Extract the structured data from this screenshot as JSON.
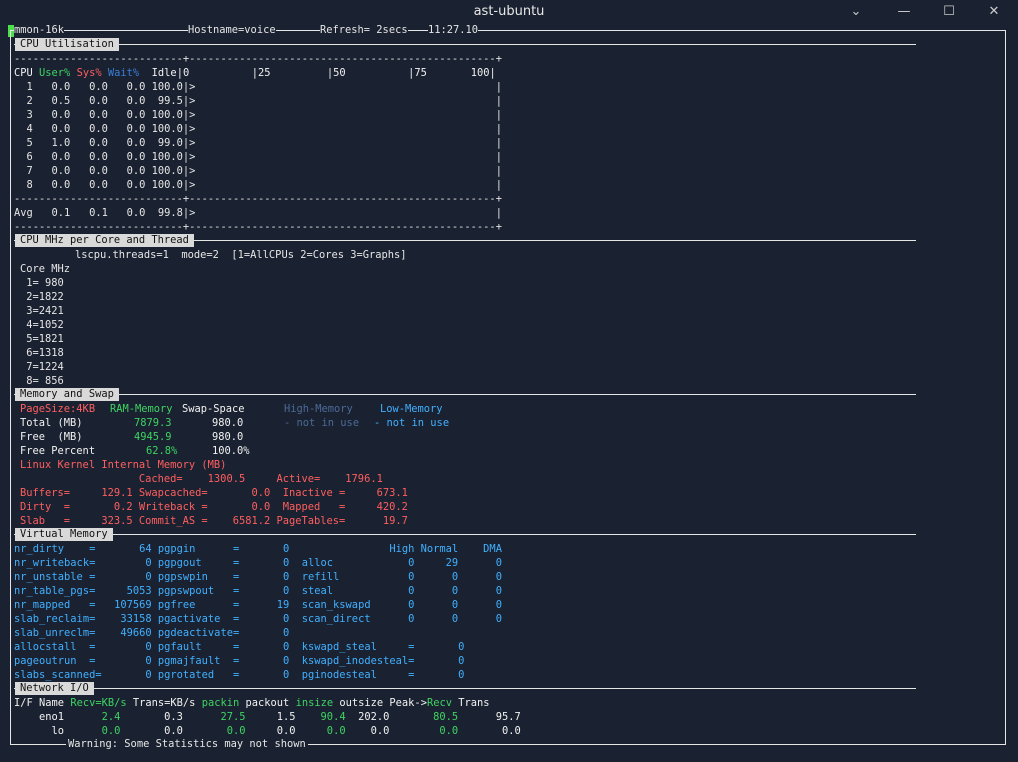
{
  "window": {
    "title": "ast-ubuntu",
    "min": "⌄",
    "restore": "—",
    "max": "☐",
    "close": "✕"
  },
  "header": {
    "left": "mmon-16k",
    "host": "Hostname=voice",
    "refresh": "Refresh= 2secs",
    "time": "11:27.10"
  },
  "sections": {
    "cpu": "CPU Utilisation",
    "mhz": "CPU MHz per Core and Thread",
    "mem": "Memory and Swap",
    "vm": "Virtual Memory",
    "net": "Network I/O"
  },
  "cpu": {
    "sep": "---------------------------+-------------------------------------------------+",
    "head": {
      "cpu": "CPU ",
      "user": "User%",
      "sys": "Sys%",
      "wait": "Wait%",
      "rest": "  Idle|0          |25         |50          |75       100|"
    },
    "rows": [
      "  1   0.0   0.0   0.0 100.0|>                                                |",
      "  2   0.5   0.0   0.0  99.5|>                                                |",
      "  3   0.0   0.0   0.0 100.0|>                                                |",
      "  4   0.0   0.0   0.0 100.0|>                                                |",
      "  5   1.0   0.0   0.0  99.0|>                                                |",
      "  6   0.0   0.0   0.0 100.0|>                                                |",
      "  7   0.0   0.0   0.0 100.0|>                                                |",
      "  8   0.0   0.0   0.0 100.0|>                                                |"
    ],
    "avg": "Avg   0.1   0.1   0.0  99.8|>                                                |"
  },
  "mhz": {
    "info": "lscpu.threads=1  mode=2  [1=AllCPUs 2=Cores 3=Graphs]",
    "head": "Core MHz",
    "rows": [
      " 1= 980",
      " 2=1822",
      " 3=2421",
      " 4=1052",
      " 5=1821",
      " 6=1318",
      " 7=1224",
      " 8= 856"
    ]
  },
  "mem": {
    "pagesize": "PageSize:4KB",
    "ram": "RAM-Memory",
    "swap": "Swap-Space",
    "high": "High-Memory",
    "low": "Low-Memory",
    "total_lbl": "Total (MB)",
    "total_ram": "7879.3",
    "total_swap": "980.0",
    "high_val": "- not in use",
    "low_val": "- not in use",
    "free_lbl": "Free  (MB)",
    "free_ram": "4945.9",
    "free_swap": "980.0",
    "pct_lbl": "Free Percent",
    "pct_ram": "62.8%",
    "pct_swap": "100.0%",
    "kernel": "Linux Kernel Internal Memory (MB)",
    "k1": "                   Cached=    1300.5     Active=    1796.1",
    "k2": "Buffers=     129.1 Swapcached=       0.0  Inactive =     673.1",
    "k3": "Dirty  =       0.2 Writeback =       0.0  Mapped   =     420.2",
    "k4": "Slab   =     323.5 Commit_AS =    6581.2 PageTables=      19.7"
  },
  "vm": {
    "rows": [
      "nr_dirty    =       64 pgpgin      =       0                High Normal    DMA",
      "nr_writeback=        0 pgpgout     =       0  alloc            0     29      0",
      "nr_unstable =        0 pgpswpin    =       0  refill           0      0      0",
      "nr_table_pgs=     5053 pgpswpout   =       0  steal            0      0      0",
      "nr_mapped   =   107569 pgfree      =      19  scan_kswapd      0      0      0",
      "slab_reclaim=    33158 pgactivate  =       0  scan_direct      0      0      0",
      "slab_unreclm=    49660 pgdeactivate=       0",
      "allocstall  =        0 pgfault     =       0  kswapd_steal     =       0",
      "pageoutrun  =        0 pgmajfault  =       0  kswapd_inodesteal=       0",
      "slabs_scanned=       0 pgrotated   =       0  pginodesteal     =       0"
    ]
  },
  "net": {
    "h_ifname": "I/F Name ",
    "h_recv": "Recv=KB/s",
    "h_trans": " Trans=KB/s ",
    "h_packin": "packin",
    "h_packout": " packout ",
    "h_insize": "insize",
    "h_outsize": " outsize Peak->",
    "h_precv": "Recv",
    "h_ptrans": " Trans",
    "eno1": {
      "name": "    eno1",
      "recv": "      2.4",
      "trans": "       0.3",
      "packin": "      27.5",
      "packout": "     1.5",
      "insize": "    90.4",
      "outsize": "  202.0",
      "precv": "       80.5",
      "ptrans": "      95.7"
    },
    "lo": {
      "name": "      lo",
      "recv": "      0.0",
      "trans": "       0.0",
      "packin": "       0.0",
      "packout": "     0.0",
      "insize": "     0.0",
      "outsize": "    0.0",
      "precv": "        0.0",
      "ptrans": "       0.0"
    }
  },
  "warning": "Warning: Some Statistics may not shown"
}
